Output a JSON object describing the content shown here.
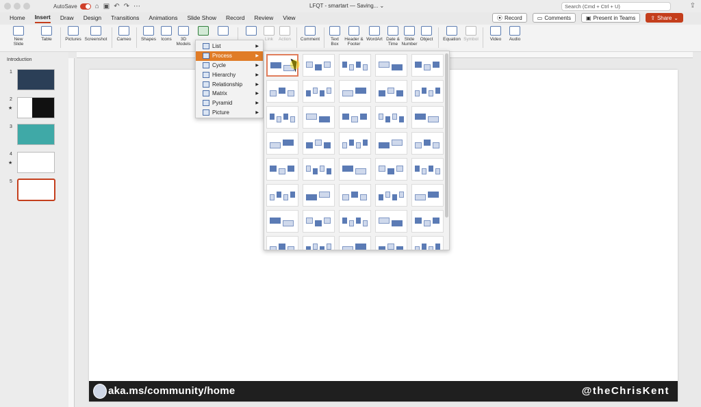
{
  "window": {
    "autosave_label": "AutoSave",
    "title": "LFQT - smartart — Saving... ⌄",
    "search_placeholder": "Search (Cmd + Ctrl + U)"
  },
  "tabs": [
    "Home",
    "Insert",
    "Draw",
    "Design",
    "Transitions",
    "Animations",
    "Slide Show",
    "Record",
    "Review",
    "View"
  ],
  "active_tab": "Insert",
  "right_buttons": {
    "record": "Record",
    "comments": "Comments",
    "teams": "Present in Teams",
    "share": "Share"
  },
  "ribbon": {
    "new_slide": "New Slide",
    "table": "Table",
    "pictures": "Pictures",
    "screenshot": "Screenshot",
    "cameo": "Cameo",
    "shapes": "Shapes",
    "icons": "Icons",
    "models": "3D Models",
    "link": "Link",
    "action": "Action",
    "comment": "Comment",
    "text_box": "Text Box",
    "header_footer": "Header & Footer",
    "wordart": "WordArt",
    "date_time": "Date & Time",
    "slide_number": "Slide Number",
    "object": "Object",
    "equation": "Equation",
    "symbol": "Symbol",
    "video": "Video",
    "audio": "Audio"
  },
  "slides": {
    "section": "Introduction",
    "numbers": [
      "1",
      "2",
      "3",
      "4",
      "5"
    ]
  },
  "smartart_menu": [
    "List",
    "Process",
    "Cycle",
    "Hierarchy",
    "Relationship",
    "Matrix",
    "Pyramid",
    "Picture"
  ],
  "smartart_highlight": "Process",
  "footer": {
    "community": "aka.ms/community/home",
    "handle": "@theChrisKent"
  },
  "colors": {
    "accent": "#c43e1c",
    "menu_highlight": "#e07c27",
    "shape_blue": "#5b7bb5"
  }
}
